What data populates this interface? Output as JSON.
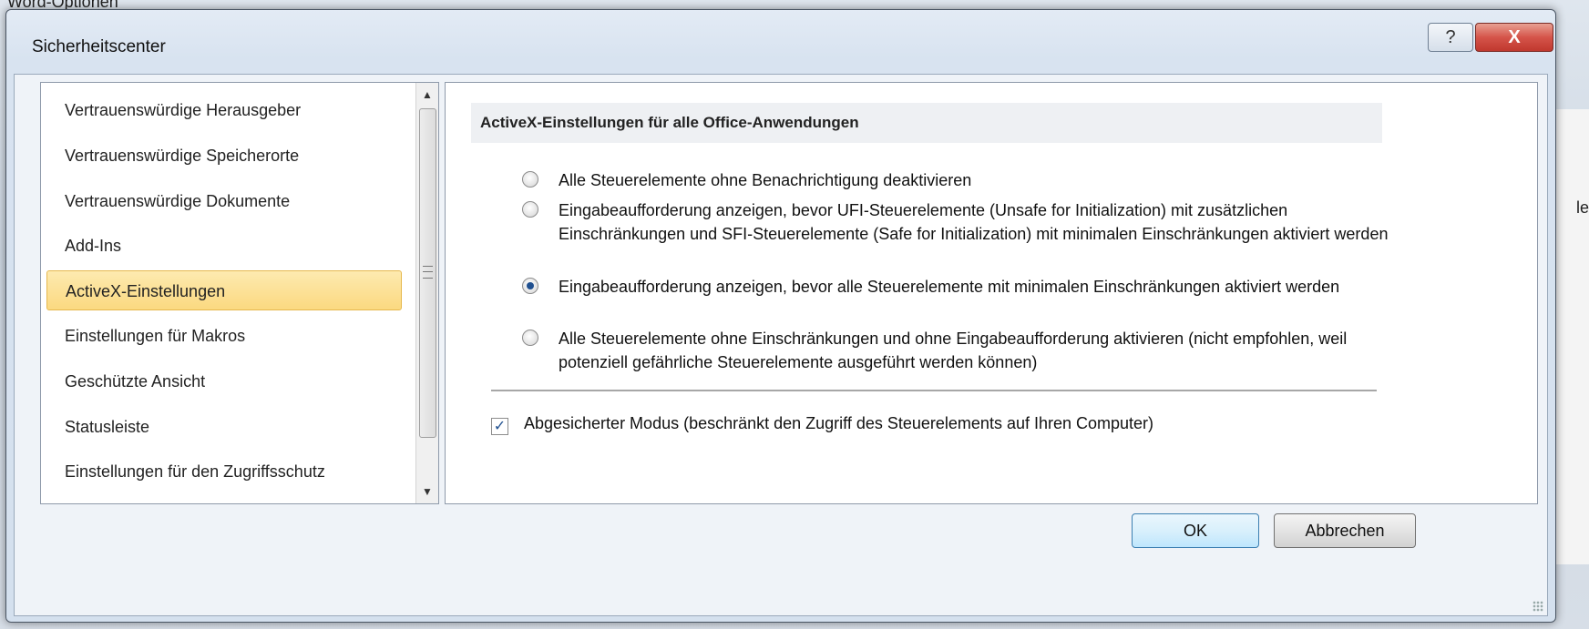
{
  "background": {
    "window_title": "Word-Optionen",
    "edge_text": "le"
  },
  "dialog": {
    "title": "Sicherheitscenter",
    "help_label": "?",
    "close_label": "X"
  },
  "nav": {
    "items": [
      {
        "label": "Vertrauenswürdige Herausgeber",
        "selected": false
      },
      {
        "label": "Vertrauenswürdige Speicherorte",
        "selected": false
      },
      {
        "label": "Vertrauenswürdige Dokumente",
        "selected": false
      },
      {
        "label": "Add-Ins",
        "selected": false
      },
      {
        "label": "ActiveX-Einstellungen",
        "selected": true
      },
      {
        "label": "Einstellungen für Makros",
        "selected": false
      },
      {
        "label": "Geschützte Ansicht",
        "selected": false
      },
      {
        "label": "Statusleiste",
        "selected": false
      },
      {
        "label": "Einstellungen für den Zugriffsschutz",
        "selected": false
      }
    ]
  },
  "content": {
    "section_header": "ActiveX-Einstellungen für alle Office-Anwendungen",
    "options": [
      {
        "label": "Alle Steuerelemente ohne Benachrichtigung deaktivieren",
        "checked": false
      },
      {
        "label": "Eingabeaufforderung anzeigen, bevor UFI-Steuerelemente (Unsafe for Initialization) mit zusätzlichen Einschränkungen und SFI-Steuerelemente (Safe for Initialization) mit minimalen Einschränkungen aktiviert werden",
        "checked": false
      },
      {
        "label": "Eingabeaufforderung anzeigen, bevor alle Steuerelemente mit minimalen Einschränkungen aktiviert werden",
        "checked": true
      },
      {
        "label": "Alle Steuerelemente ohne Einschränkungen und ohne Eingabeaufforderung aktivieren (nicht empfohlen, weil potenziell gefährliche Steuerelemente ausgeführt werden können)",
        "checked": false
      }
    ],
    "safe_mode": {
      "label": "Abgesicherter Modus (beschränkt den Zugriff des Steuerelements auf Ihren Computer)",
      "checked": true,
      "check_glyph": "✓"
    }
  },
  "buttons": {
    "ok": "OK",
    "cancel": "Abbrechen"
  },
  "scrollbar": {
    "up_glyph": "▲",
    "down_glyph": "▼"
  },
  "colors": {
    "selected_bg": "#fbd980",
    "close_red": "#c0382e",
    "ok_border": "#3c7fb1"
  }
}
